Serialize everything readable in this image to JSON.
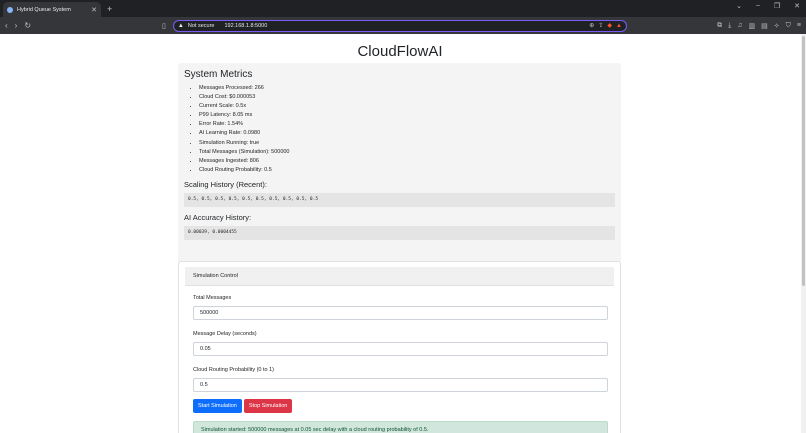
{
  "browser": {
    "tab_title": "Hybrid Queue System",
    "security_label": "Not secure",
    "url": "192.168.1.8:5000"
  },
  "page": {
    "title": "CloudFlowAI"
  },
  "metrics": {
    "heading": "System Metrics",
    "items": [
      "Messages Processed: 266",
      "Cloud Cost: $0.000053",
      "Current Scale: 0.5x",
      "P99 Latency: 8.05 ms",
      "Error Rate: 1.54%",
      "AI Learning Rate: 0.0980",
      "Simulation Running: true",
      "Total Messages (Simulation): 500000",
      "Messages Ingested: 806",
      "Cloud Routing Probability: 0.5"
    ],
    "scaling_heading": "Scaling History (Recent):",
    "scaling_values": "0.5, 0.5, 0.5, 0.5, 0.5, 0.5, 0.5, 0.5, 0.5, 0.5",
    "accuracy_heading": "AI Accuracy History:",
    "accuracy_values": "0.00039, 0.0004455"
  },
  "simulation": {
    "header": "Simulation Control",
    "total_label": "Total Messages",
    "total_value": "500000",
    "delay_label": "Message Delay (seconds)",
    "delay_value": "0.05",
    "prob_label": "Cloud Routing Probability (0 to 1)",
    "prob_value": "0.5",
    "start_label": "Start Simulation",
    "stop_label": "Stop Simulation",
    "status": "Simulation started: 500000 messages at 0.05 sec delay with a cloud routing probability of 0.5."
  }
}
